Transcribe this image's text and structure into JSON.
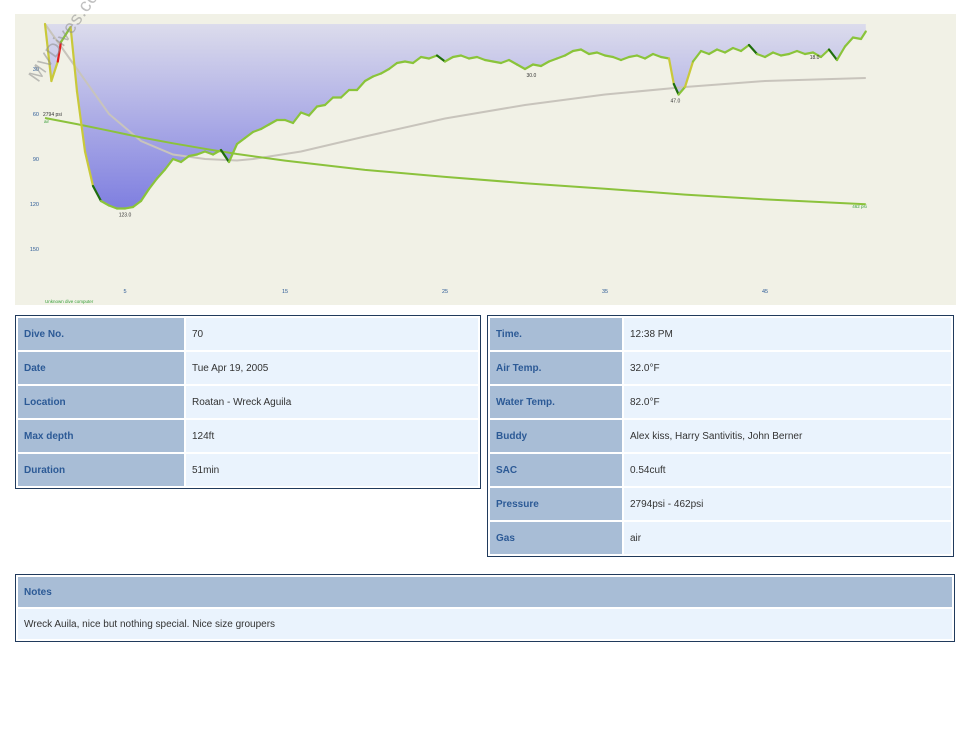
{
  "profile": {
    "watermark": "MVDives.com",
    "computer_label": "Unknown dive computer",
    "start_pressure_label": "2794 psi",
    "start_gas_label": "air",
    "end_pressure_label": "462 psi",
    "depth_ticks": [
      "30",
      "60",
      "90",
      "120",
      "150"
    ],
    "time_ticks": [
      "5",
      "15",
      "25",
      "35",
      "45"
    ],
    "depth_annotations": [
      {
        "text": "123.0",
        "time_min": 5.0,
        "depth_ft": 123
      },
      {
        "text": "30.0",
        "time_min": 30.4,
        "depth_ft": 30
      },
      {
        "text": "47.0",
        "time_min": 39.4,
        "depth_ft": 47
      },
      {
        "text": "18.0",
        "time_min": 48.1,
        "depth_ft": 18
      }
    ],
    "colors": {
      "background": "#f1f1e6",
      "depth_fill_top": "#dcdcec",
      "depth_fill_bottom": "#7f7fe0",
      "depth_line_normal": "#8ac43a",
      "depth_line_slow": "#1f6e0d",
      "depth_line_medium": "#c9c93a",
      "depth_line_fast": "#e01c1c",
      "pressure_line": "#8bc23c",
      "tissue_line": "#c8c4bc",
      "tick_text": "#2c5a96",
      "label_text": "#3aa03a"
    }
  },
  "chart_data": {
    "type": "line",
    "title": "",
    "xlabel": "",
    "ylabel": "",
    "xlim": [
      0,
      52
    ],
    "ylim": [
      180,
      0
    ],
    "x_unit": "min",
    "y_unit": "ft",
    "series": [
      {
        "key": "depth",
        "x": [
          0,
          0.4,
          0.8,
          1.0,
          1.6,
          2.0,
          2.5,
          3.0,
          3.5,
          4.0,
          4.5,
          5.0,
          5.5,
          6.0,
          6.5,
          7.0,
          7.5,
          8.0,
          8.5,
          9.0,
          9.5,
          10.0,
          10.5,
          11.0,
          11.5,
          12.0,
          12.5,
          13.0,
          13.5,
          14.0,
          14.5,
          15.0,
          15.5,
          16.0,
          16.5,
          17.0,
          17.5,
          18.0,
          18.5,
          19.0,
          19.5,
          20.0,
          20.5,
          21.0,
          21.5,
          22.0,
          22.5,
          23.0,
          23.5,
          24.0,
          24.5,
          25.0,
          25.5,
          26.0,
          26.5,
          27.0,
          27.5,
          28.0,
          28.5,
          29.0,
          29.5,
          30.0,
          30.5,
          31.0,
          31.5,
          32.0,
          32.5,
          33.0,
          33.5,
          34.0,
          34.5,
          35.0,
          35.5,
          36.0,
          36.5,
          37.0,
          37.5,
          38.0,
          38.5,
          39.0,
          39.3,
          39.6,
          40.0,
          40.5,
          41.0,
          41.5,
          42.0,
          42.5,
          43.0,
          43.5,
          44.0,
          44.5,
          45.0,
          45.5,
          46.0,
          46.5,
          47.0,
          47.5,
          48.0,
          48.5,
          49.0,
          49.5,
          50.0,
          50.5,
          51.0,
          51.3
        ],
        "values": [
          0,
          38,
          25,
          12,
          2,
          45,
          85,
          108,
          118,
          121,
          123,
          123,
          122,
          118,
          110,
          103,
          97,
          90,
          92,
          88,
          87,
          85,
          87,
          84,
          92,
          80,
          76,
          72,
          70,
          67,
          64,
          64,
          66,
          59,
          61,
          55,
          54,
          49,
          49,
          44,
          44,
          38,
          35,
          33,
          30,
          26,
          25,
          26,
          22,
          23,
          21,
          25,
          22,
          21,
          23,
          22,
          24,
          25,
          26,
          24,
          27,
          30,
          27,
          28,
          25,
          23,
          21,
          18,
          17,
          20,
          19,
          21,
          22,
          24,
          22,
          21,
          23,
          20,
          22,
          23,
          40,
          47,
          42,
          25,
          18,
          20,
          17,
          19,
          16,
          18,
          14,
          20,
          22,
          19,
          21,
          20,
          18,
          20,
          19,
          22,
          17,
          24,
          15,
          9,
          10,
          5
        ]
      },
      {
        "key": "tank_pressure",
        "unit": "psi",
        "x": [
          0,
          2,
          4,
          6,
          8,
          10,
          12,
          15,
          20,
          25,
          30,
          35,
          40,
          45,
          51.3
        ],
        "values": [
          2794,
          2630,
          2450,
          2270,
          2110,
          1960,
          1820,
          1640,
          1390,
          1200,
          1030,
          880,
          720,
          590,
          462
        ]
      },
      {
        "key": "tissue_ceiling",
        "x": [
          0,
          2,
          4,
          6,
          8,
          10,
          12,
          13,
          16,
          20,
          25,
          30,
          35,
          40,
          45,
          51.3
        ],
        "values": [
          0,
          30,
          60,
          78,
          87,
          90,
          91,
          90,
          85,
          75,
          63,
          54,
          47,
          42,
          38,
          36
        ]
      }
    ]
  },
  "dive_info": {
    "left": [
      {
        "label": "Dive No.",
        "value": "70"
      },
      {
        "label": "Date",
        "value": "Tue Apr 19, 2005"
      },
      {
        "label": "Location",
        "value": "Roatan - Wreck Aguila"
      },
      {
        "label": "Max depth",
        "value": "124ft"
      },
      {
        "label": "Duration",
        "value": "51min"
      }
    ],
    "right": [
      {
        "label": "Time.",
        "value": "12:38 PM"
      },
      {
        "label": "Air Temp.",
        "value": "32.0°F"
      },
      {
        "label": "Water Temp.",
        "value": "82.0°F"
      },
      {
        "label": "Buddy",
        "value": "Alex kiss, Harry Santivitis, John Berner"
      },
      {
        "label": "SAC",
        "value": "0.54cuft"
      },
      {
        "label": "Pressure",
        "value": "2794psi - 462psi"
      },
      {
        "label": "Gas",
        "value": "air"
      }
    ]
  },
  "notes": {
    "label": "Notes",
    "text": "Wreck Auila, nice but nothing special. Nice size groupers"
  }
}
